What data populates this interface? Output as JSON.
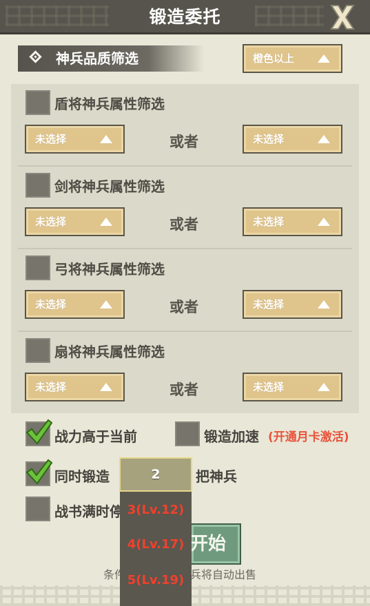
{
  "header": {
    "title": "锻造委托",
    "close_icon": "close-x-icon"
  },
  "quality_filter": {
    "label": "神兵品质筛选",
    "icon": "diamond-icon",
    "selected": "橙色以上"
  },
  "sections": [
    {
      "title": "盾将神兵属性筛选",
      "left": "未选择",
      "or": "或者",
      "right": "未选择"
    },
    {
      "title": "剑将神兵属性筛选",
      "left": "未选择",
      "or": "或者",
      "right": "未选择"
    },
    {
      "title": "弓将神兵属性筛选",
      "left": "未选择",
      "or": "或者",
      "right": "未选择"
    },
    {
      "title": "扇将神兵属性筛选",
      "left": "未选择",
      "or": "或者",
      "right": "未选择"
    }
  ],
  "options": {
    "power_higher": {
      "label": "战力高于当前",
      "checked": true
    },
    "speed_up": {
      "label": "锻造加速",
      "note": "(开通月卡激活)",
      "checked": false
    },
    "simultaneous": {
      "prefix": "同时锻造",
      "suffix": "把神兵",
      "checked": true
    },
    "book_full": {
      "label": "战书满时停",
      "checked": false
    }
  },
  "count_select": {
    "value": "2",
    "options": [
      "3(Lv.12)",
      "4(Lv.17)",
      "5(Lv.19)"
    ]
  },
  "start_button": {
    "label": "开始"
  },
  "footnote": {
    "left": "条件",
    "right": "兵将自动出售"
  },
  "colors": {
    "accent_gold": "#dfc48b",
    "check_green": "#6cc23a",
    "option_red": "#f2402b",
    "note_red": "#e8523b"
  }
}
